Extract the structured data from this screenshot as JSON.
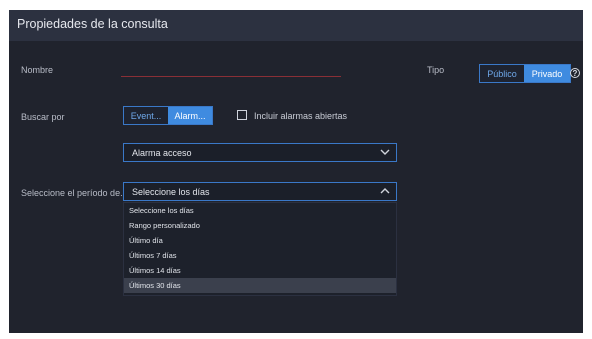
{
  "dialog": {
    "title": "Propiedades de la consulta"
  },
  "form": {
    "nombre_label": "Nombre",
    "tipo_label": "Tipo",
    "tipo_options": [
      "Público",
      "Privado"
    ],
    "tipo_selected": "Privado",
    "buscar_label": "Buscar por",
    "buscar_options": [
      "Event...",
      "Alarm..."
    ],
    "buscar_selected": "Alarm...",
    "incluir_label": "Incluir alarmas abiertas",
    "incluir_checked": false,
    "alarm_select_value": "Alarma acceso",
    "periodo_label": "Seleccione el período de...",
    "periodo_select_value": "Seleccione los días",
    "periodo_options": [
      "Seleccione los días",
      "Rango personalizado",
      "Último día",
      "Últimos 7 días",
      "Últimos 14 días",
      "Últimos 30 días"
    ],
    "periodo_highlighted": "Últimos 30 días"
  },
  "colors": {
    "accent": "#3f8be0",
    "background": "#20232d",
    "header": "#2c3140",
    "error_line": "#8a2f36"
  },
  "icons": {
    "help": "help-circle-icon",
    "chevron_down": "chevron-down-icon",
    "chevron_up": "chevron-up-icon"
  }
}
